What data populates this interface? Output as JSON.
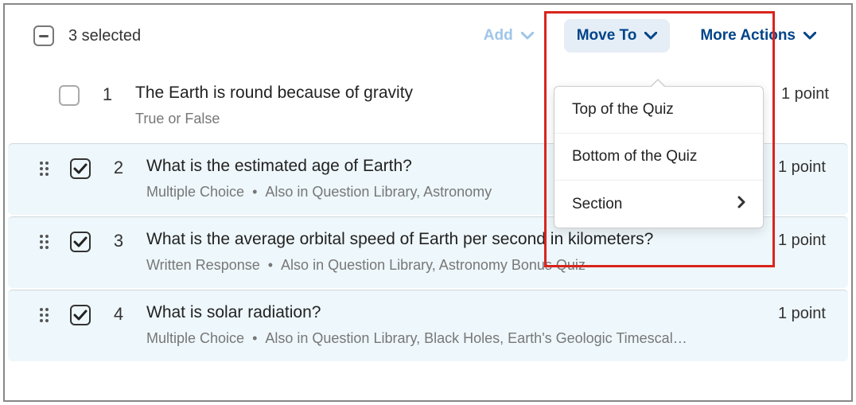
{
  "header": {
    "selected_label": "3 selected",
    "add_label": "Add",
    "move_to_label": "Move To",
    "more_actions_label": "More Actions"
  },
  "dropdown": {
    "items": [
      {
        "label": "Top of the Quiz",
        "has_submenu": false
      },
      {
        "label": "Bottom of the Quiz",
        "has_submenu": false
      },
      {
        "label": "Section",
        "has_submenu": true
      }
    ]
  },
  "questions": [
    {
      "number": "1",
      "selected": false,
      "title": "The Earth is round because of gravity",
      "type": "True or False",
      "meta_extra": "",
      "points": "1 point"
    },
    {
      "number": "2",
      "selected": true,
      "title": "What is the estimated age of Earth?",
      "type": "Multiple Choice",
      "meta_extra": "Also in Question Library, Astronomy",
      "points": "1 point"
    },
    {
      "number": "3",
      "selected": true,
      "title": "What is the average orbital speed of Earth per second in kilometers?",
      "type": "Written Response",
      "meta_extra": "Also in Question Library, Astronomy Bonus Quiz",
      "points": "1 point"
    },
    {
      "number": "4",
      "selected": true,
      "title": "What is solar radiation?",
      "type": "Multiple Choice",
      "meta_extra": "Also in Question Library, Black Holes, Earth's Geologic Timescal…",
      "points": "1 point"
    }
  ]
}
